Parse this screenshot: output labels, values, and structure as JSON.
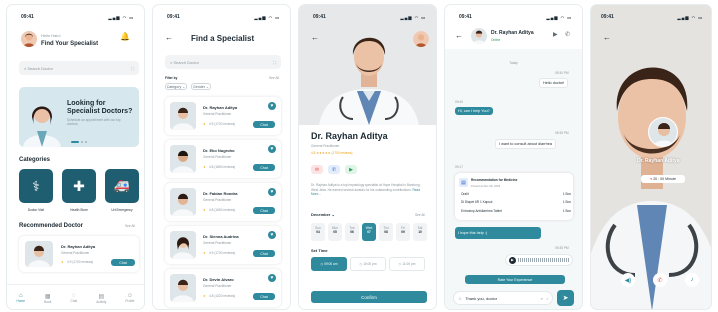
{
  "status": {
    "time": "09:41"
  },
  "p1": {
    "greeting": "Hello Halo!",
    "title": "Find Your Specialist",
    "search_placeholder": "Search Doctor",
    "banner_title": "Looking for Specialist Doctors?",
    "banner_sub": "Schedule an appointment with our top doctors.",
    "categories_title": "Categories",
    "categories": [
      {
        "label": "Doctor Visit",
        "icon": "stethoscope-icon"
      },
      {
        "label": "Health Store",
        "icon": "first-aid-kit-icon"
      },
      {
        "label": "Urt Emergency",
        "icon": "ambulance-icon"
      }
    ],
    "recommended_title": "Recommended Doctor",
    "see_all": "See All",
    "rec": {
      "name": "Dr. Rayhan Aditya",
      "role": "General Practitioner",
      "rating": "4.9 (1700 reviews)",
      "btn": "Chat"
    },
    "nav": [
      "Home",
      "Book",
      "Chat",
      "Activity",
      "Profile"
    ]
  },
  "p2": {
    "title": "Find a Specialist",
    "search_placeholder": "Search Doctor",
    "filter_label": "Filter by",
    "see_all": "See All",
    "filters": [
      "Category",
      "Gender"
    ],
    "doctors": [
      {
        "name": "Dr. Rayhan Aditya",
        "role": "General Practitioner",
        "rating": "4.9 (1700 reviews)",
        "btn": "Chat"
      },
      {
        "name": "Dr. Eko Nugroho",
        "role": "General Practitioner",
        "rating": "4.8 (1850 reviews)",
        "btn": "Chat"
      },
      {
        "name": "Dr. Fabian Rondra",
        "role": "General Practitioner",
        "rating": "4.8 (1650 reviews)",
        "btn": "Chat"
      },
      {
        "name": "Dr. Sienna Audrina",
        "role": "General Practitioner",
        "rating": "4.9 (1700 reviews)",
        "btn": "Chat"
      },
      {
        "name": "Dr. Devin Alvaro",
        "role": "General Practitioner",
        "rating": "4.8 (1320 reviews)",
        "btn": "Chat"
      }
    ]
  },
  "p3": {
    "name": "Dr. Rayhan Aditya",
    "role": "General Practitioner",
    "rating": "4.8 ★★★★★ (1700 reviews)",
    "bio": "Dr. Rayhan Aditya is a top hepatology specialist at Hope Hospital in Bandung, West Java. He earned several awards for his outstanding contributions.",
    "read_more": "Read More...",
    "month": "December",
    "see_all": "See All",
    "days": [
      {
        "d": "Sun",
        "n": "04"
      },
      {
        "d": "Mon",
        "n": "05"
      },
      {
        "d": "Tue",
        "n": "06"
      },
      {
        "d": "Wed",
        "n": "07"
      },
      {
        "d": "Thu",
        "n": "08"
      },
      {
        "d": "Fri",
        "n": "09"
      },
      {
        "d": "Sat",
        "n": "10"
      }
    ],
    "set_time": "Set Time",
    "times": [
      "09:00 am",
      "10:00 pm",
      "11:00 pm",
      "12:00 pm",
      "13:00 pm",
      "14:00 pm"
    ],
    "confirm": "Confirm"
  },
  "p4": {
    "name": "Dr. Rayhan Aditya",
    "status": "Online",
    "today": "Today",
    "messages": [
      {
        "t": "09:30 PM",
        "text": "Hello doctor!",
        "me": true
      },
      {
        "t": "09:40",
        "text": "Hi, can I help You?",
        "me": false
      },
      {
        "t": "09:35 PM",
        "text": "I want to consult about diarrhea",
        "me": true
      },
      {
        "t": "09:17",
        "text": "I hope this help :)",
        "me": false
      },
      {
        "t": "09:35 PM",
        "text": "",
        "me": true
      }
    ],
    "rec_title": "Recommendation for Medicine",
    "rec_date": "Posted at Dec 09, 2023",
    "rec_items": [
      {
        "n": "Oralit",
        "q": "1 Box"
      },
      {
        "n": "Di Diapet 6R 1 Kapsul",
        "q": "1 Box"
      },
      {
        "n": "Entrostop Antidiarrhea Tablet",
        "q": "1 Box"
      }
    ],
    "rate_btn": "Rate Your Experience",
    "input_value": "Thank you, doctor"
  },
  "p5": {
    "name": "Dr. Rayhan Aditya",
    "timer": "20 : 00 Minute"
  }
}
